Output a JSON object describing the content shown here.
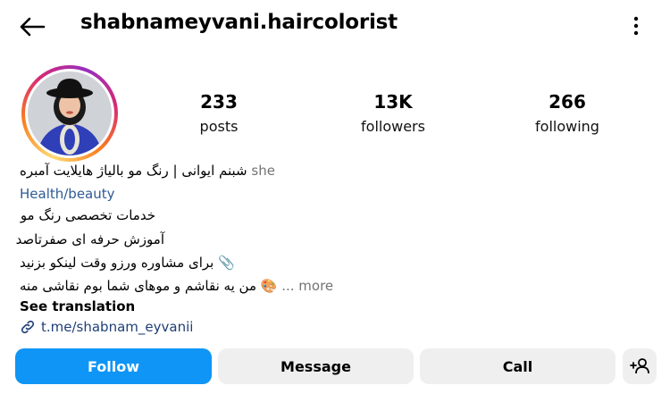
{
  "header": {
    "username": "shabnameyvani.haircolorist",
    "back_icon": "arrow-left-icon",
    "more_icon": "more-vertical-icon"
  },
  "stats": {
    "posts": {
      "value": "233",
      "label": "posts"
    },
    "followers": {
      "value": "13K",
      "label": "followers"
    },
    "following": {
      "value": "266",
      "label": "following"
    }
  },
  "bio": {
    "pronoun": "she",
    "name_line": "شبنم ایوانی | رنگ مو  بالیاژ هایلایت آمبره",
    "category": "Health/beauty",
    "line1": "خدمات تخصصی رنگ مو",
    "line2": "آموزش حرفه ای صفرتاصد",
    "line3": "برای مشاوره ورزو وقت لینکو بزنید",
    "line3_icon": "📎",
    "line4": "من یه نقاشم و موهای شما بوم نقاشی منه",
    "line4_icon": "🎨",
    "more_label": "... more",
    "see_translation": "See translation",
    "link": "t.me/shabnam_eyvanii"
  },
  "actions": {
    "follow": "Follow",
    "message": "Message",
    "call": "Call",
    "add_user_icon": "add-user-icon"
  },
  "colors": {
    "follow_bg": "#0f95f6",
    "secondary_bg": "#efefef",
    "link": "#1f3f75",
    "category": "#2e5a94",
    "muted": "#737373"
  }
}
